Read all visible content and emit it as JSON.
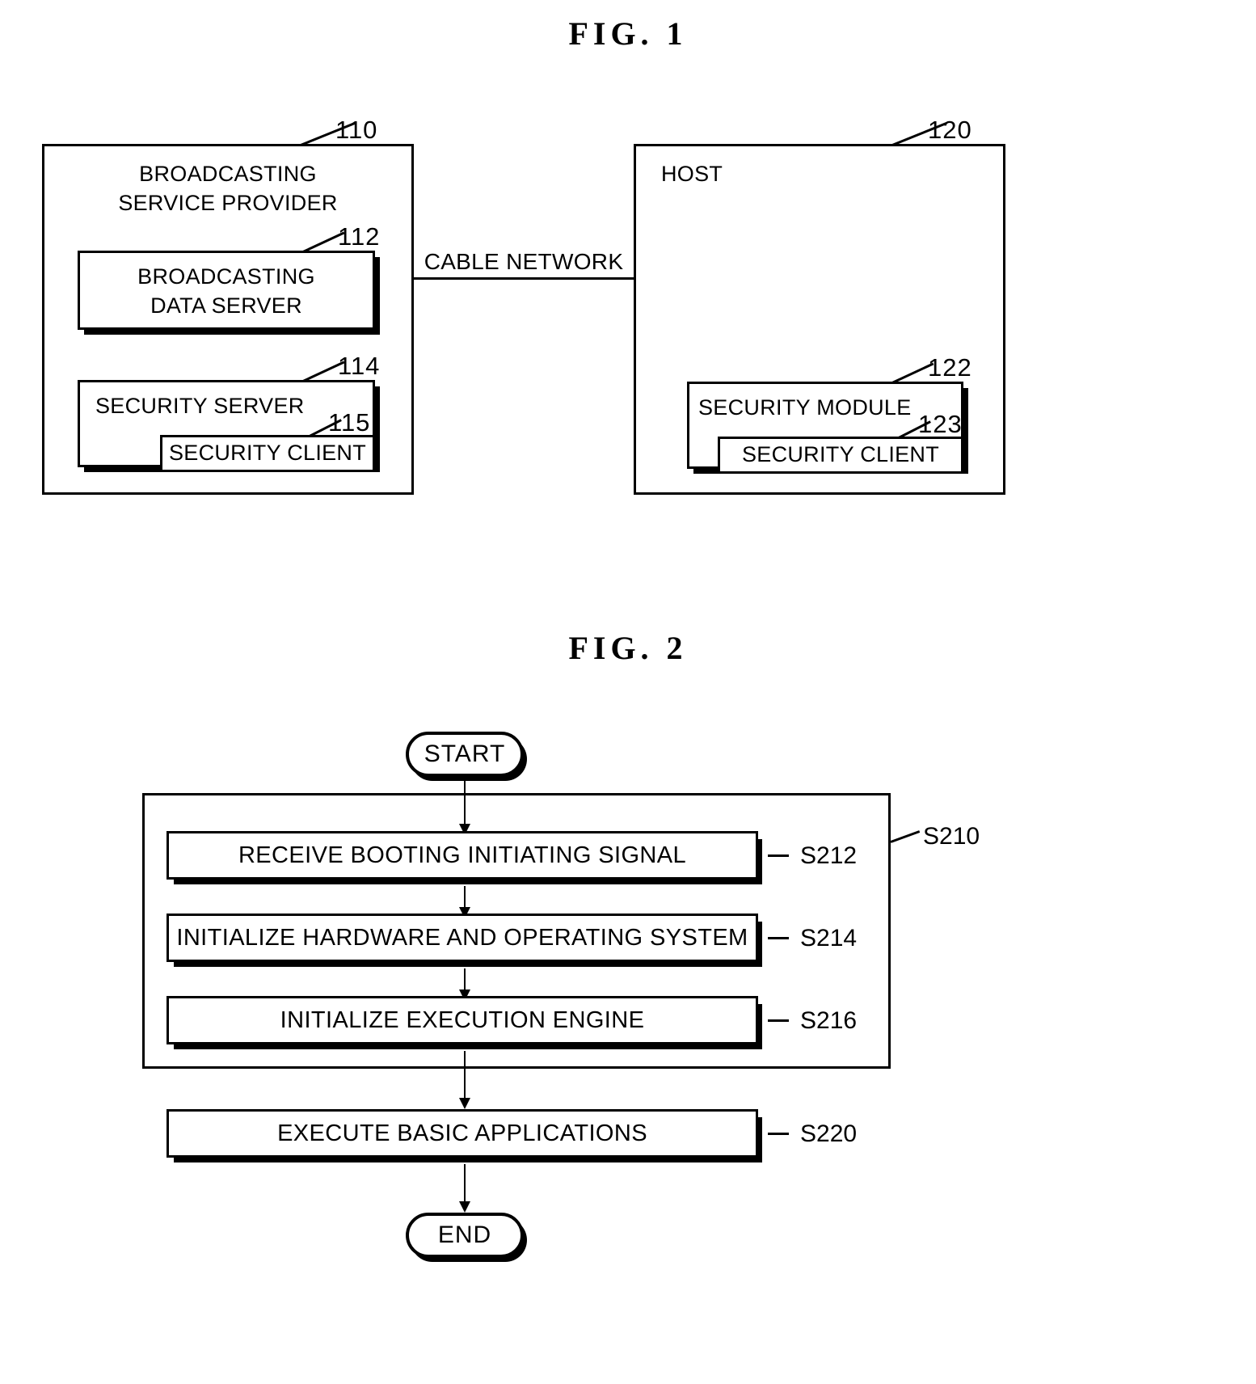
{
  "figures": {
    "fig1": {
      "title": "FIG.  1",
      "network_label": "CABLE NETWORK",
      "provider": {
        "ref": "110",
        "label_line1": "BROADCASTING",
        "label_line2": "SERVICE PROVIDER",
        "data_server": {
          "ref": "112",
          "label_line1": "BROADCASTING",
          "label_line2": "DATA SERVER"
        },
        "security_server": {
          "ref": "114",
          "label": "SECURITY SERVER",
          "security_client": {
            "ref": "115",
            "label": "SECURITY CLIENT"
          }
        }
      },
      "host": {
        "ref": "120",
        "label": "HOST",
        "security_module": {
          "ref": "122",
          "label": "SECURITY MODULE",
          "security_client": {
            "ref": "123",
            "label": "SECURITY CLIENT"
          }
        }
      }
    },
    "fig2": {
      "title": "FIG.  2",
      "start_label": "START",
      "end_label": "END",
      "group": {
        "ref": "S210"
      },
      "steps": [
        {
          "ref": "S212",
          "label": "RECEIVE BOOTING INITIATING SIGNAL"
        },
        {
          "ref": "S214",
          "label": "INITIALIZE HARDWARE AND OPERATING SYSTEM"
        },
        {
          "ref": "S216",
          "label": "INITIALIZE EXECUTION ENGINE"
        },
        {
          "ref": "S220",
          "label": "EXECUTE BASIC APPLICATIONS"
        }
      ]
    }
  }
}
